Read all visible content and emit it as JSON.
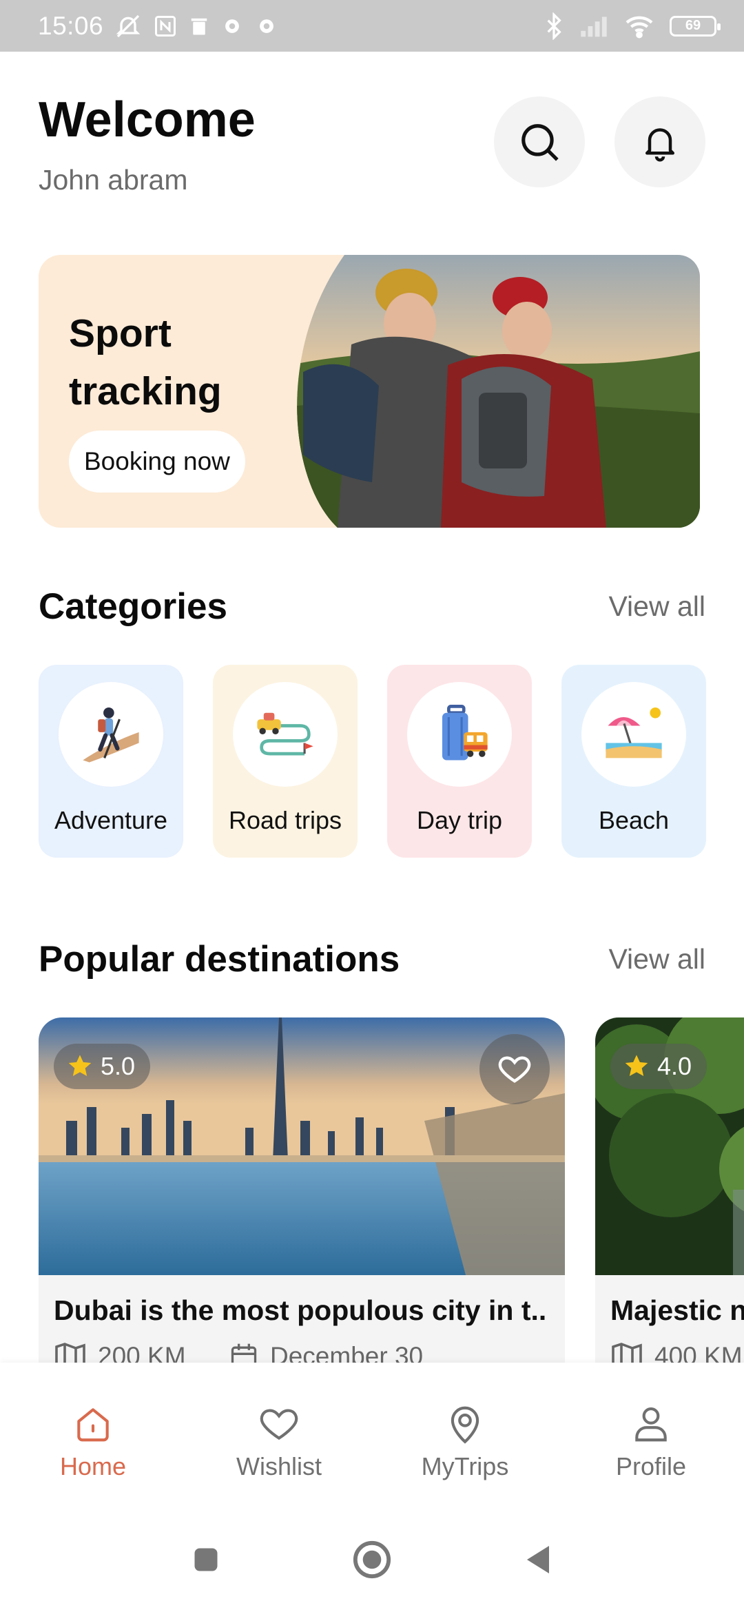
{
  "status_bar": {
    "time": "15:06",
    "battery": "69"
  },
  "header": {
    "title": "Welcome",
    "user_name": "John abram"
  },
  "banner": {
    "title_line1": "Sport",
    "title_line2": "tracking",
    "button_label": "Booking now"
  },
  "categories": {
    "title": "Categories",
    "view_all": "View all",
    "items": [
      {
        "label": "Adventure",
        "bg": "#e8f1fe"
      },
      {
        "label": "Road trips",
        "bg": "#fcf3e2"
      },
      {
        "label": "Day trip",
        "bg": "#fde6e8"
      },
      {
        "label": "Beach",
        "bg": "#e5f2fd"
      }
    ]
  },
  "popular": {
    "title": "Popular destinations",
    "view_all": "View all",
    "cards": [
      {
        "rating": "5.0",
        "title": "Dubai is the most populous city in t..",
        "distance": "200 KM",
        "date": "December 30"
      },
      {
        "rating": "4.0",
        "title": "Majestic n",
        "distance": "400 KM"
      }
    ]
  },
  "bottom_nav": {
    "items": [
      {
        "label": "Home"
      },
      {
        "label": "Wishlist"
      },
      {
        "label": "MyTrips"
      },
      {
        "label": "Profile"
      }
    ]
  },
  "colors": {
    "accent": "#d96a4d",
    "star": "#f6c31a"
  }
}
